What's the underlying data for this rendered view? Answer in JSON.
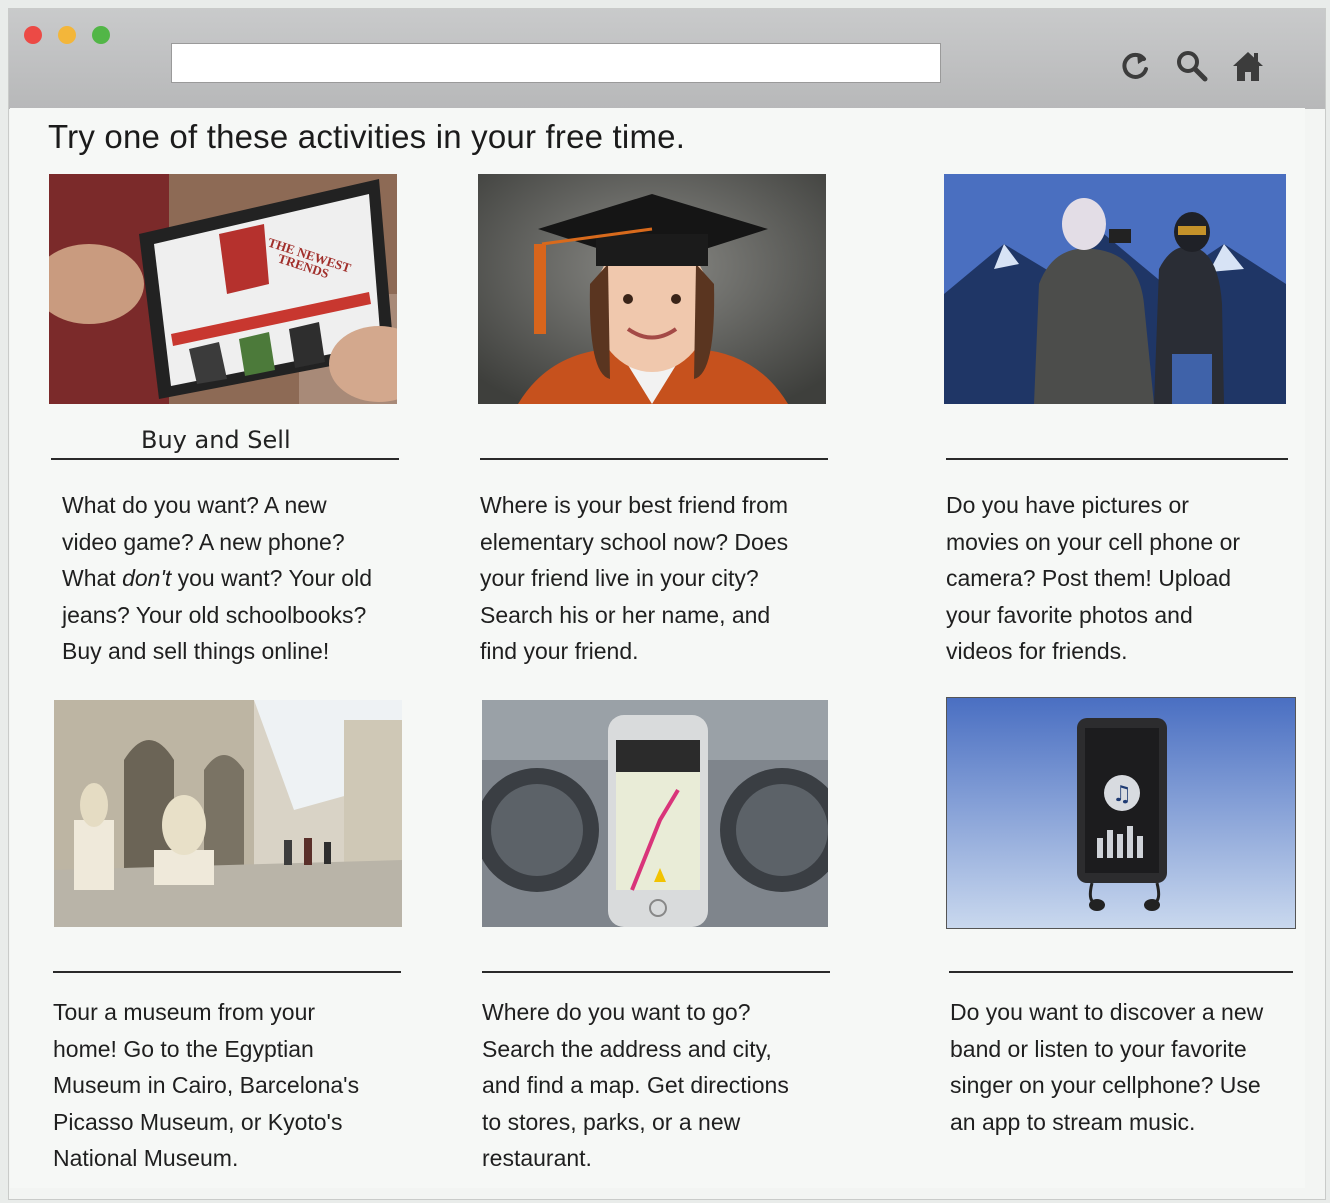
{
  "browser": {
    "window_controls": [
      "close",
      "minimize",
      "maximize"
    ],
    "address_value": "",
    "toolbar_icons": [
      "reload-icon",
      "search-icon",
      "home-icon"
    ]
  },
  "page": {
    "heading": "Try one of these activities in your free time.",
    "activities": [
      {
        "image": "tablet-shopping-site",
        "image_text": [
          "THE NEWEST",
          "TRENDS"
        ],
        "caption": "Buy and Sell",
        "lines": [
          "What do you want? A new",
          "video game? A new phone?",
          [
            "What ",
            "don't",
            " you want? Your old"
          ],
          "jeans? Your old schoolbooks?",
          "Buy and sell things online!"
        ]
      },
      {
        "image": "girl-graduation-cap",
        "caption": "",
        "lines": [
          "Where is your best friend from",
          "elementary school now? Does",
          "your friend live in your city?",
          "Search his or her name, and",
          "find your friend."
        ]
      },
      {
        "image": "people-taking-photos-mountains",
        "caption": "",
        "lines": [
          "Do you have pictures or",
          "movies on your cell phone or",
          "camera? Post them! Upload",
          "your favorite photos and",
          "videos for friends."
        ]
      },
      {
        "image": "museum-sculpture-hall",
        "caption": "",
        "lines": [
          "Tour a museum from your",
          "home! Go to the Egyptian",
          "Museum in Cairo, Barcelona's",
          "Picasso Museum, or Kyoto's",
          "National Museum."
        ]
      },
      {
        "image": "phone-map-car-dashboard",
        "caption": "",
        "lines": [
          "Where do you want to go?",
          "Search the address and city,",
          "and find a map. Get directions",
          "to stores, parks, or a new",
          "restaurant."
        ]
      },
      {
        "image": "phone-music-app-earbuds",
        "caption": "",
        "lines": [
          "Do you want to discover a new",
          "band or listen to your favorite",
          "singer on your cellphone? Use",
          "an app to stream music."
        ]
      }
    ]
  }
}
